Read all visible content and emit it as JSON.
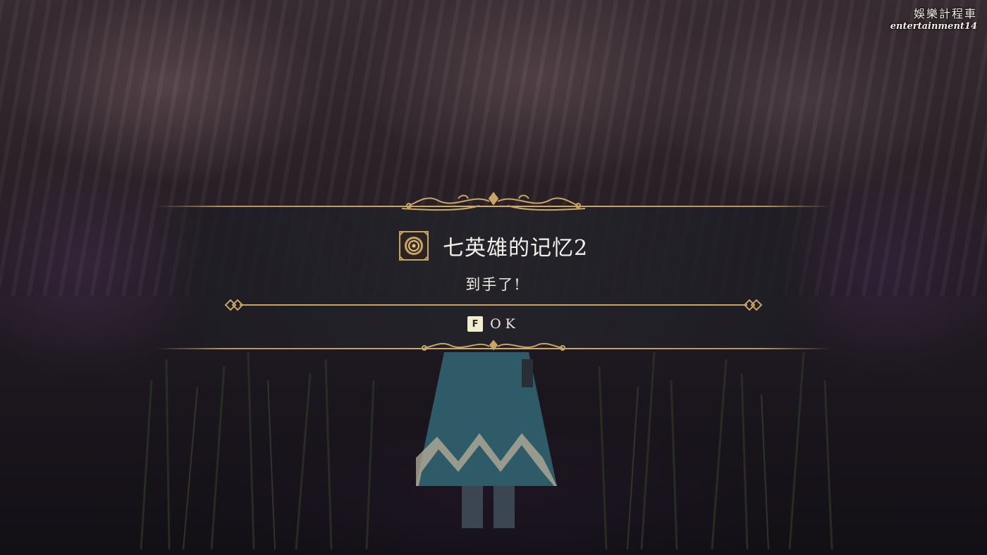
{
  "watermark": {
    "chinese": "娛樂計程車",
    "english": "entertainment14"
  },
  "dialog": {
    "item_icon": "medallion-icon",
    "item_name": "七英雄的记忆2",
    "message": "到手了!",
    "confirm_key": "F",
    "confirm_label": "OK"
  },
  "colors": {
    "gold_accent": "#c9a465",
    "panel_bg": "#24242a",
    "text": "#f4f1ea",
    "key_badge": "#f3edcf"
  }
}
